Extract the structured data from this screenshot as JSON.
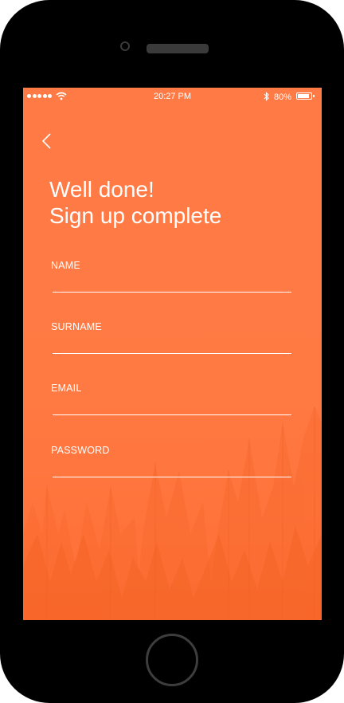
{
  "status_bar": {
    "time": "20:27 PM",
    "battery": "80%"
  },
  "header": {
    "back_icon": "chevron-left-icon",
    "title_line1": "Well done!",
    "title_line2": "Sign up complete"
  },
  "form": {
    "fields": [
      {
        "label": "NAME",
        "value": ""
      },
      {
        "label": "SURNAME",
        "value": ""
      },
      {
        "label": "EMAIL",
        "value": ""
      },
      {
        "label": "PASSWORD",
        "value": ""
      }
    ]
  },
  "colors": {
    "background": "#ff7a43",
    "text": "#ffffff",
    "device": "#000000"
  }
}
